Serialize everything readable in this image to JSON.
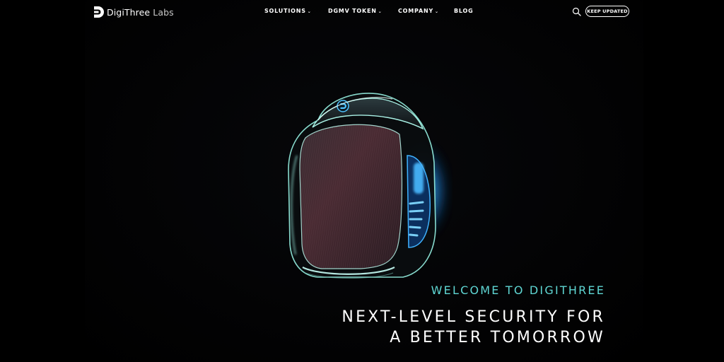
{
  "brand": {
    "name_bold": "DigiThree",
    "name_light": " Labs",
    "logo_icon": "digithree-logo-icon",
    "accent_color": "#5fd6d3"
  },
  "nav": {
    "items": [
      {
        "label": "SOLUTIONS",
        "has_dropdown": true
      },
      {
        "label": "DGMV TOKEN",
        "has_dropdown": true
      },
      {
        "label": "COMPANY",
        "has_dropdown": true
      },
      {
        "label": "BLOG",
        "has_dropdown": false
      }
    ],
    "chevron": "⌄"
  },
  "header": {
    "search_icon": "search-icon",
    "cta_label": "KEEP UPDATED"
  },
  "hero": {
    "kicker": "WELCOME TO DIGITHREE",
    "title_line1": "NEXT-LEVEL SECURITY FOR",
    "title_line2": "A BETTER TOMORROW",
    "image_icon": "hardware-wallet-device-illustration"
  }
}
